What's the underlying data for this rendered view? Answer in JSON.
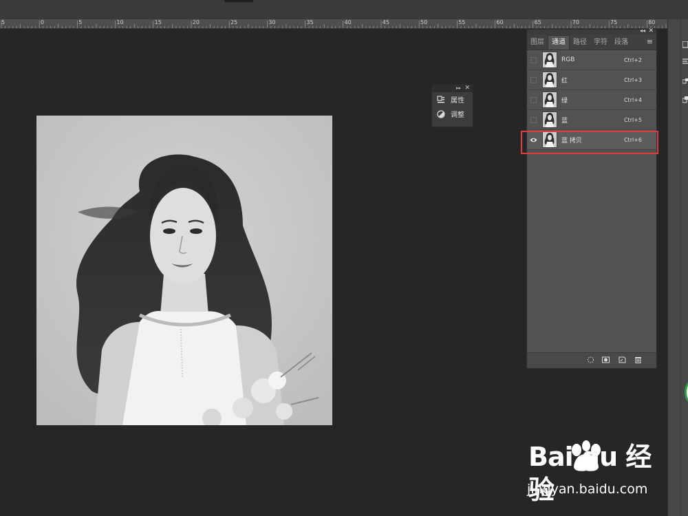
{
  "ruler": {
    "labels": [
      "5",
      "0",
      "5",
      "10",
      "15",
      "20",
      "25",
      "30",
      "35",
      "40",
      "45",
      "50",
      "55",
      "60",
      "65",
      "70",
      "75",
      "80"
    ]
  },
  "mini_panel": {
    "items": [
      {
        "label": "属性",
        "icon": "properties-icon"
      },
      {
        "label": "调整",
        "icon": "adjustments-icon"
      }
    ]
  },
  "channels_panel": {
    "tabs": [
      "图层",
      "通道",
      "路径",
      "字符",
      "段落"
    ],
    "active_tab": "通道",
    "rows": [
      {
        "name": "RGB",
        "shortcut": "Ctrl+2",
        "visible": false
      },
      {
        "name": "红",
        "shortcut": "Ctrl+3",
        "visible": false
      },
      {
        "name": "绿",
        "shortcut": "Ctrl+4",
        "visible": false
      },
      {
        "name": "蓝",
        "shortcut": "Ctrl+5",
        "visible": false
      },
      {
        "name": "蓝 拷贝",
        "shortcut": "Ctrl+6",
        "visible": true,
        "selected": true
      }
    ],
    "highlight_color": "#e23b3b"
  },
  "watermark": {
    "logo": "Bai du 经验",
    "url": "jingyan.baidu.com"
  }
}
